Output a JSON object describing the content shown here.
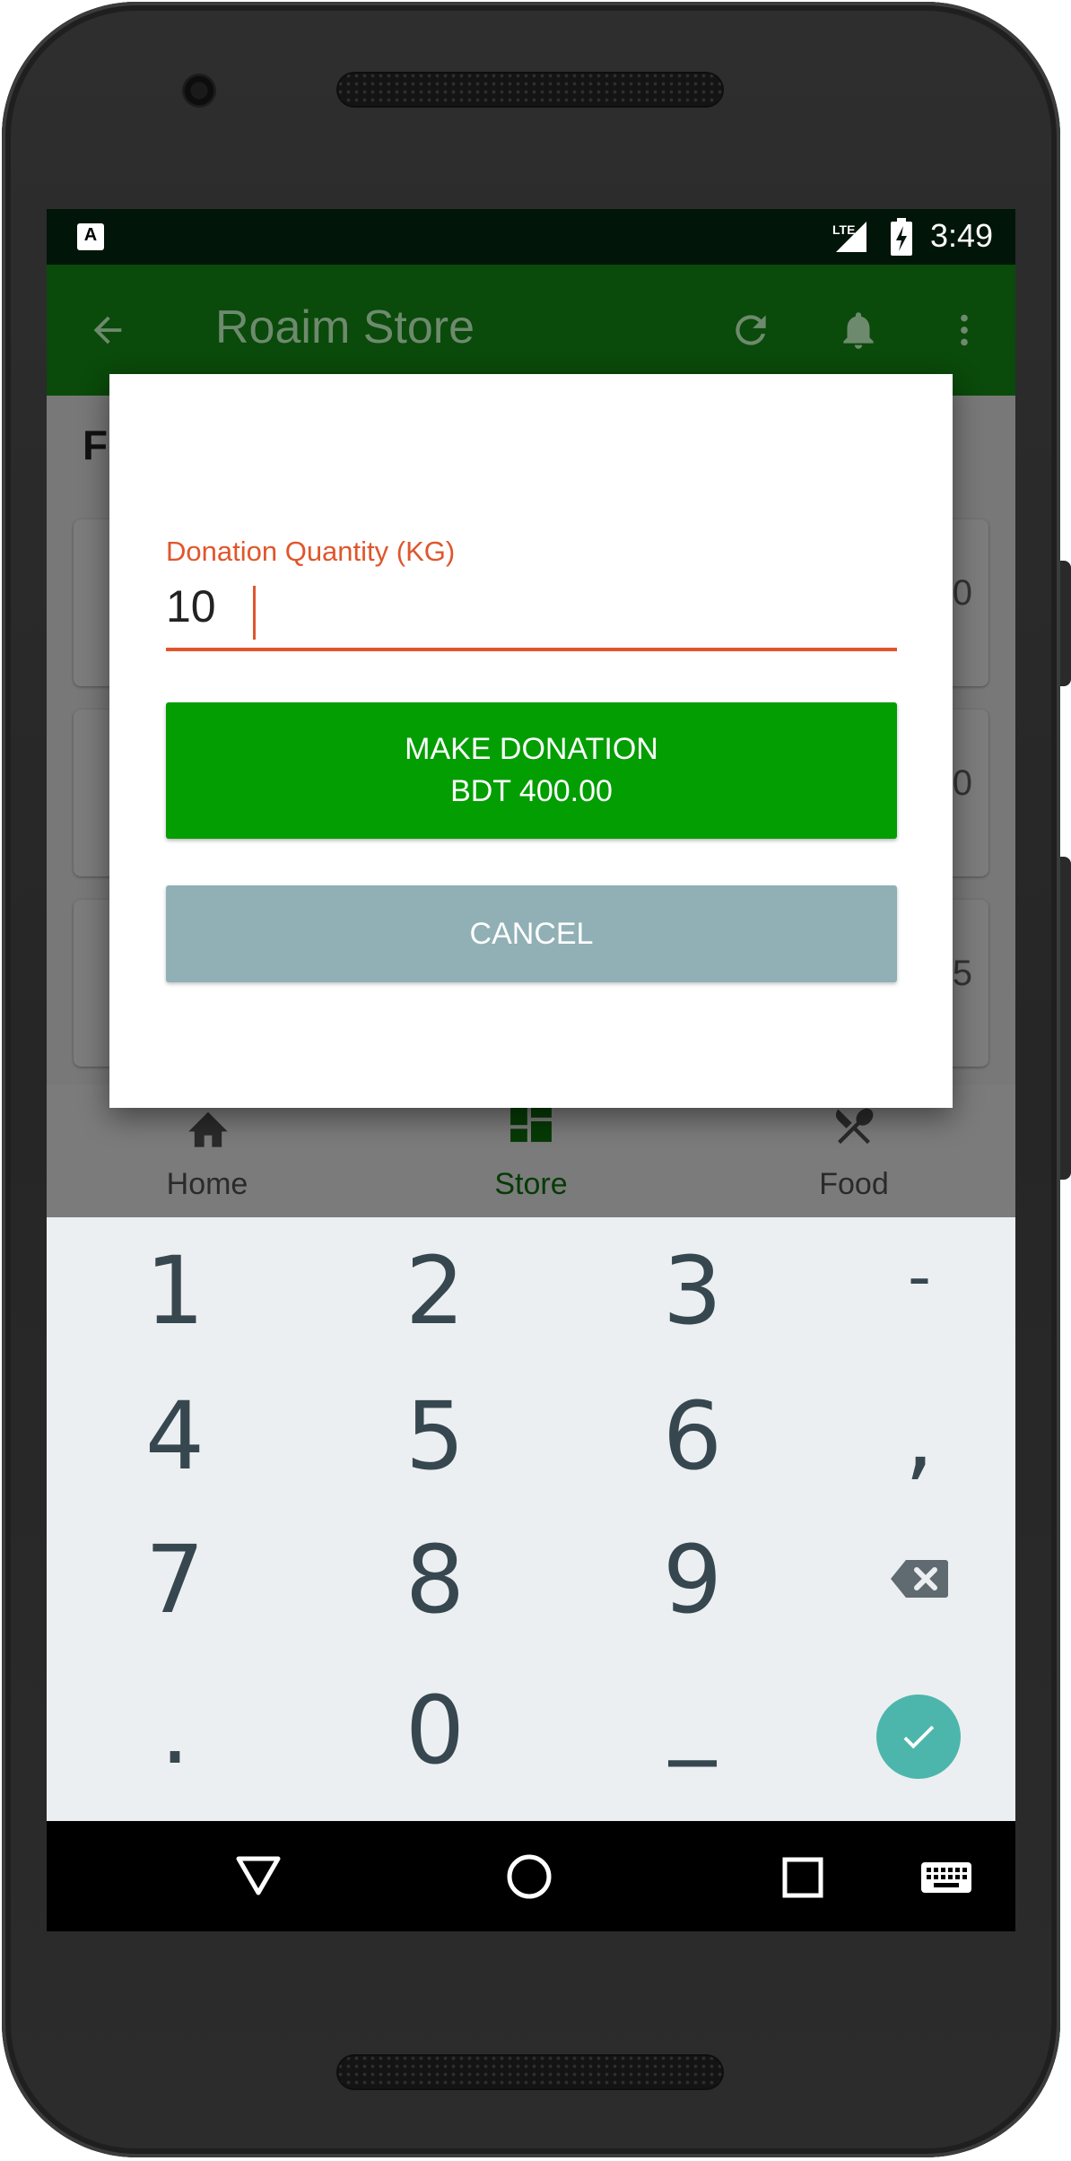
{
  "status_bar": {
    "notification_icon": "a-icon",
    "notification_letter": "A",
    "network": "LTE",
    "battery": "charging",
    "time": "3:49"
  },
  "app_bar": {
    "title": "Roaim Store",
    "back_icon": "arrow-back-icon",
    "refresh_icon": "refresh-icon",
    "notifications_icon": "bell-icon",
    "overflow_icon": "more-vert-icon",
    "color": "#0a4a0a"
  },
  "background_content": {
    "heading_partial": "F",
    "card_tails": [
      "0",
      "0",
      "5"
    ]
  },
  "dialog": {
    "field_label": "Donation Quantity (KG)",
    "field_value": "10",
    "donate_button": {
      "line1": "MAKE DONATION",
      "line2": "BDT 400.00",
      "color": "#029e02"
    },
    "cancel_button": {
      "label": "CANCEL",
      "color": "#90b0b5"
    },
    "accent_color": "#e0562c"
  },
  "bottom_nav": {
    "items": [
      {
        "label": "Home",
        "icon": "home-icon"
      },
      {
        "label": "Store",
        "icon": "store-icon",
        "active": true
      },
      {
        "label": "Food",
        "icon": "food-icon"
      }
    ]
  },
  "keyboard": {
    "rows": [
      [
        "1",
        "2",
        "3",
        "-"
      ],
      [
        "4",
        "5",
        "6",
        ","
      ],
      [
        "7",
        "8",
        "9",
        "backspace"
      ],
      [
        ".",
        "0",
        "_",
        "done"
      ]
    ],
    "done_color": "#4db6ac"
  },
  "system_nav": {
    "back_icon": "triangle-back-icon",
    "home_icon": "circle-home-icon",
    "recents_icon": "square-recents-icon",
    "keyboard_icon": "keyboard-icon"
  }
}
